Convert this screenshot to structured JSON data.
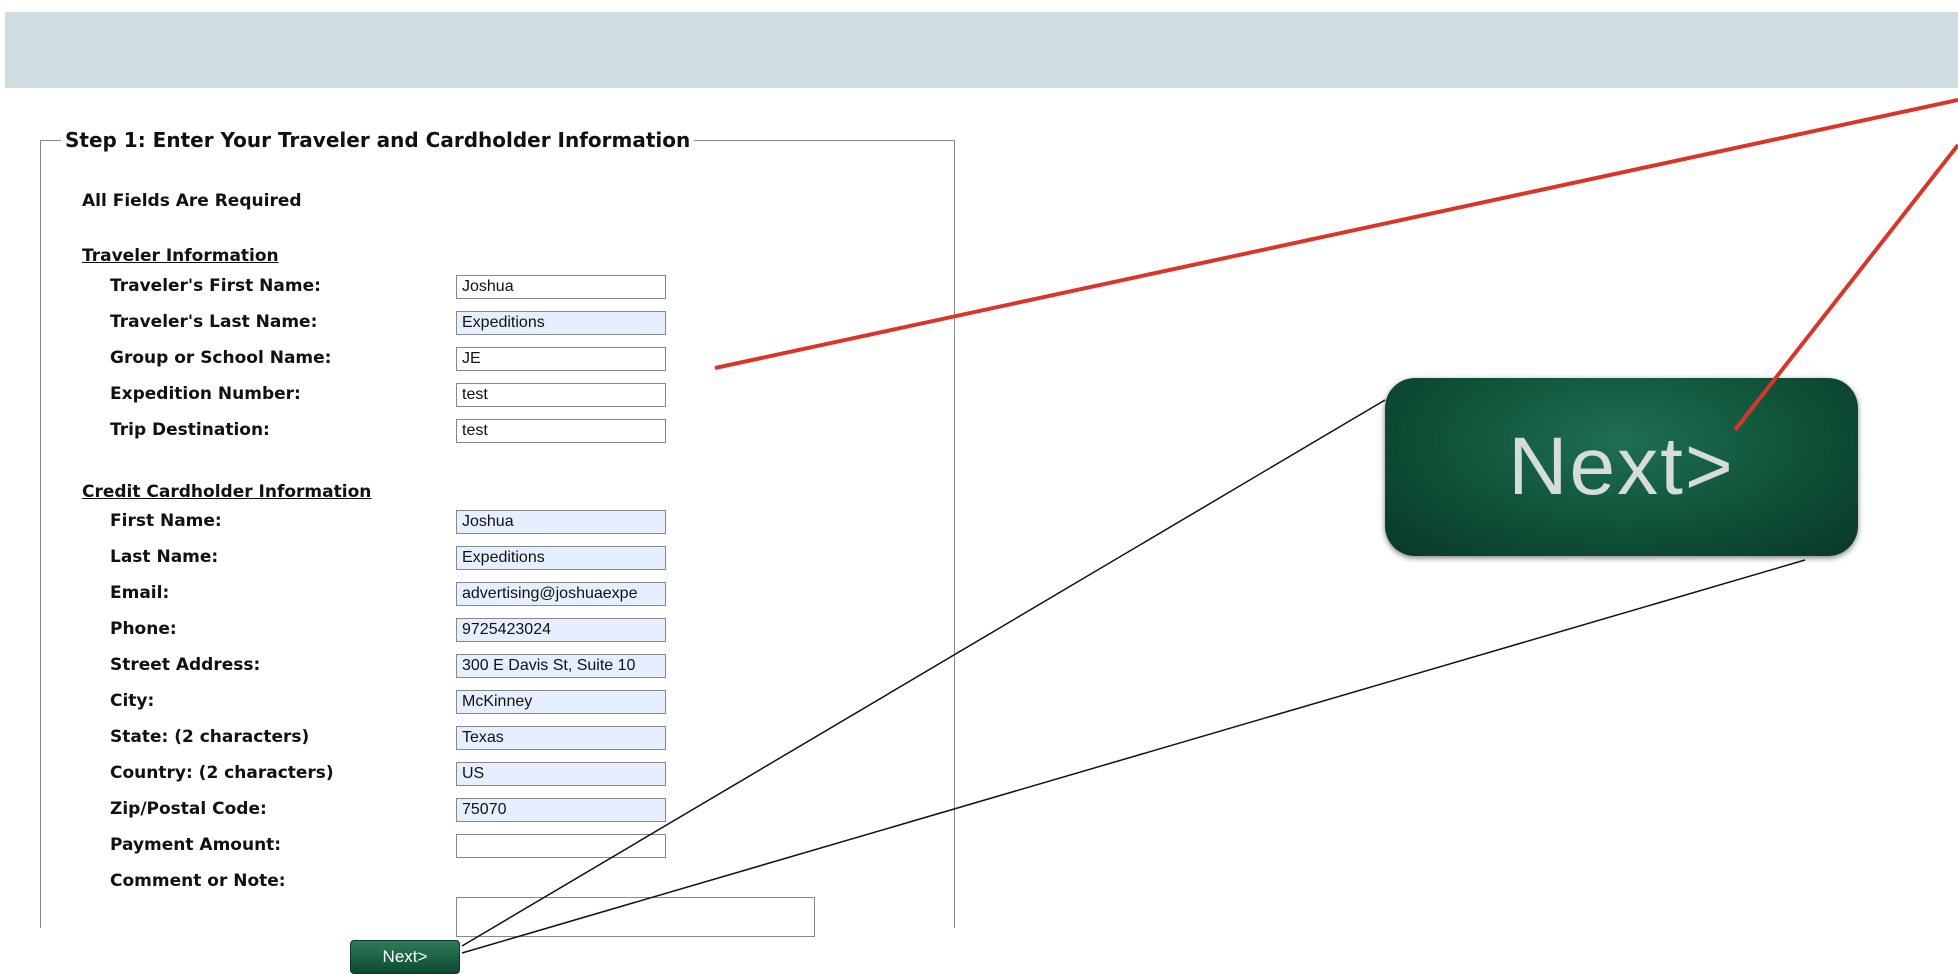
{
  "form": {
    "legend": "Step 1: Enter Your Traveler and Cardholder Information",
    "required_note": "All Fields Are Required",
    "traveler_heading": "Traveler Information",
    "cardholder_heading": "Credit Cardholder Information",
    "traveler_fields": [
      {
        "label": "Traveler's First Name:",
        "value": "Joshua",
        "filled": false
      },
      {
        "label": "Traveler's Last Name:",
        "value": "Expeditions",
        "filled": true
      },
      {
        "label": "Group or School Name:",
        "value": "JE",
        "filled": false
      },
      {
        "label": "Expedition Number:",
        "value": "test",
        "filled": false
      },
      {
        "label": "Trip Destination:",
        "value": "test",
        "filled": false
      }
    ],
    "cardholder_fields": [
      {
        "label": "First Name:",
        "value": "Joshua",
        "filled": true
      },
      {
        "label": "Last Name:",
        "value": "Expeditions",
        "filled": true
      },
      {
        "label": "Email:",
        "value": "advertising@joshuaexpe",
        "filled": true
      },
      {
        "label": "Phone:",
        "value": "9725423024",
        "filled": true
      },
      {
        "label": "Street Address:",
        "value": "300 E Davis St, Suite 10",
        "filled": true
      },
      {
        "label": "City:",
        "value": "McKinney",
        "filled": true
      },
      {
        "label": "State: (2 characters)",
        "value": "Texas",
        "filled": true
      },
      {
        "label": "Country: (2 characters)",
        "value": "US",
        "filled": true
      },
      {
        "label": "Zip/Postal Code:",
        "value": "75070",
        "filled": true
      },
      {
        "label": "Payment Amount:",
        "value": "",
        "filled": false
      }
    ],
    "comment_label": "Comment or Note:",
    "next_label": "Next>"
  },
  "zoom": {
    "next_label": "Next>"
  },
  "colors": {
    "top_band": "#cfdce1",
    "autofill_bg": "#e6efff",
    "button_green": "#0f5238",
    "annotation_red": "#d9362b",
    "annotation_black": "#111111"
  }
}
